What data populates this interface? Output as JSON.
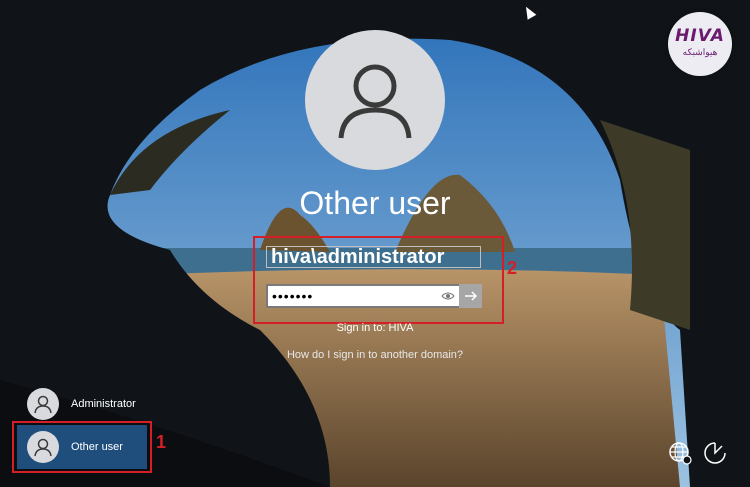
{
  "login": {
    "selected_user": "Other user",
    "username_value": "hiva\\administrator",
    "password_mask": "•••••••",
    "signin_to": "Sign in to: HIVA",
    "domain_link": "How do I sign in to another domain?"
  },
  "user_list": [
    {
      "label": "Administrator"
    },
    {
      "label": "Other user"
    }
  ],
  "annotations": {
    "step1": "1",
    "step2": "2",
    "color": "#d41f26"
  },
  "watermark": {
    "brand": "HIVA",
    "sub": "هیواشبکه"
  },
  "icons": {
    "network": "network-globe-icon",
    "accessibility": "ease-of-access-icon",
    "submit": "arrow-right-icon",
    "reveal": "eye-icon"
  }
}
